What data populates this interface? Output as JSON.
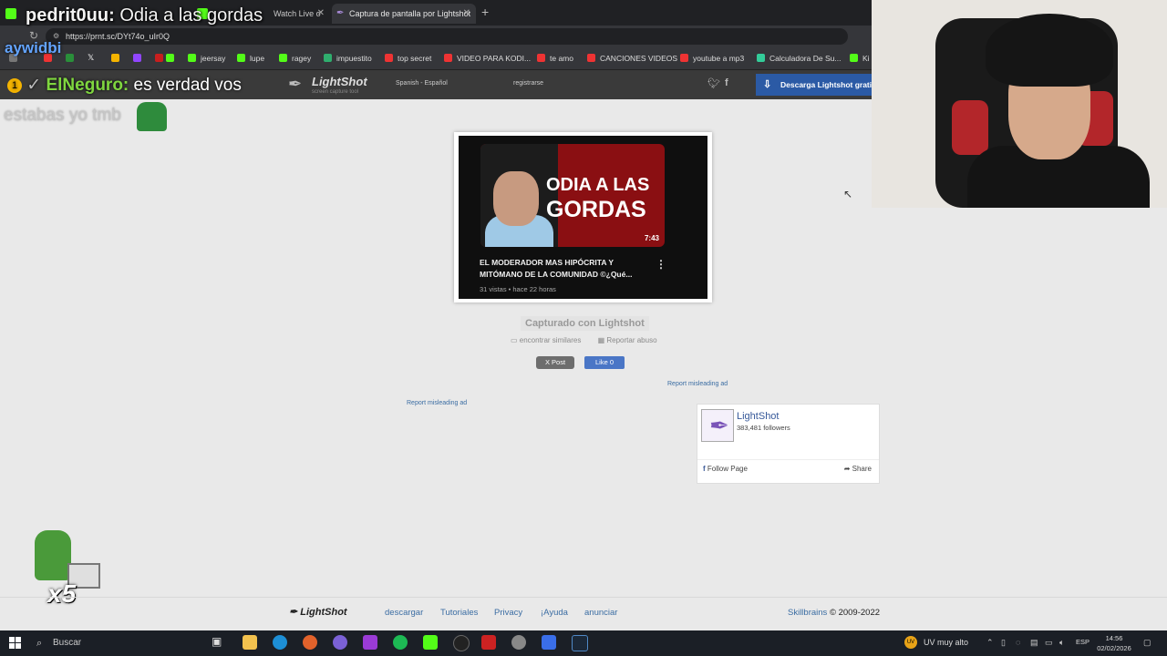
{
  "tabs": [
    {
      "label": "pedrit0uu: Odia a las gordas",
      "active": false
    },
    {
      "label": "Watch Live o",
      "active": false
    },
    {
      "label": "Captura de pantalla por Lightshot",
      "active": true
    }
  ],
  "url": "https://prnt.sc/DYt74o_uIr0Q",
  "bookmarks": [
    "jeersay",
    "lupe",
    "ragey",
    "impuestito",
    "top secret",
    "VIDEO PARA KODI...",
    "te amo",
    "CANCIONES VIDEOS",
    "youtube a mp3",
    "Calculadora De Su...",
    "Ki"
  ],
  "overlay": {
    "streamer_name": "pedrit0uu:",
    "stream_title": "Odia a las gordas",
    "user2": "aywidbi",
    "chat_badge": "1",
    "chat_user": "ElNeguro:",
    "chat_msg1": "es verdad vos",
    "chat_msg2": "estabas yo tmb",
    "multiplier": "x5"
  },
  "lightshot_header": {
    "logo_name": "LightShot",
    "logo_tagline": "screen capture tool",
    "language": "Spanish - Español",
    "register": "registrarse",
    "download_button": "Descarga Lightshot gratis"
  },
  "screenshot": {
    "thumb_line1": "ODIA A LAS",
    "thumb_line2": "GORDAS",
    "duration": "7:43",
    "video_title": "EL MODERADOR MAS HIPÓCRITA Y MITÓMANO DE LA COMUNIDAD ©¿Qué...",
    "video_meta": "31 vistas • hace 22 horas"
  },
  "captured_label": "Capturado con Lightshot",
  "find_similar": "encontrar similares",
  "report_abuse": "Reportar abuso",
  "x_post": "X Post",
  "fb_like": "Like 0",
  "report_ad": "Report misleading ad",
  "fb_widget": {
    "page_name": "LightShot",
    "followers": "383,481 followers",
    "follow": "Follow Page",
    "share": "Share"
  },
  "footer": {
    "logo": "LightShot",
    "links": [
      "descargar",
      "Tutoriales",
      "Privacy",
      "¡Ayuda",
      "anunciar"
    ],
    "brand": "Skillbrains",
    "copyright": "© 2009-2022"
  },
  "taskbar": {
    "search_placeholder": "Buscar",
    "uv_badge": "UV",
    "uv_label": "UV muy alto",
    "lang": "ESP",
    "time": "14:56",
    "date": "02/02/2026"
  }
}
